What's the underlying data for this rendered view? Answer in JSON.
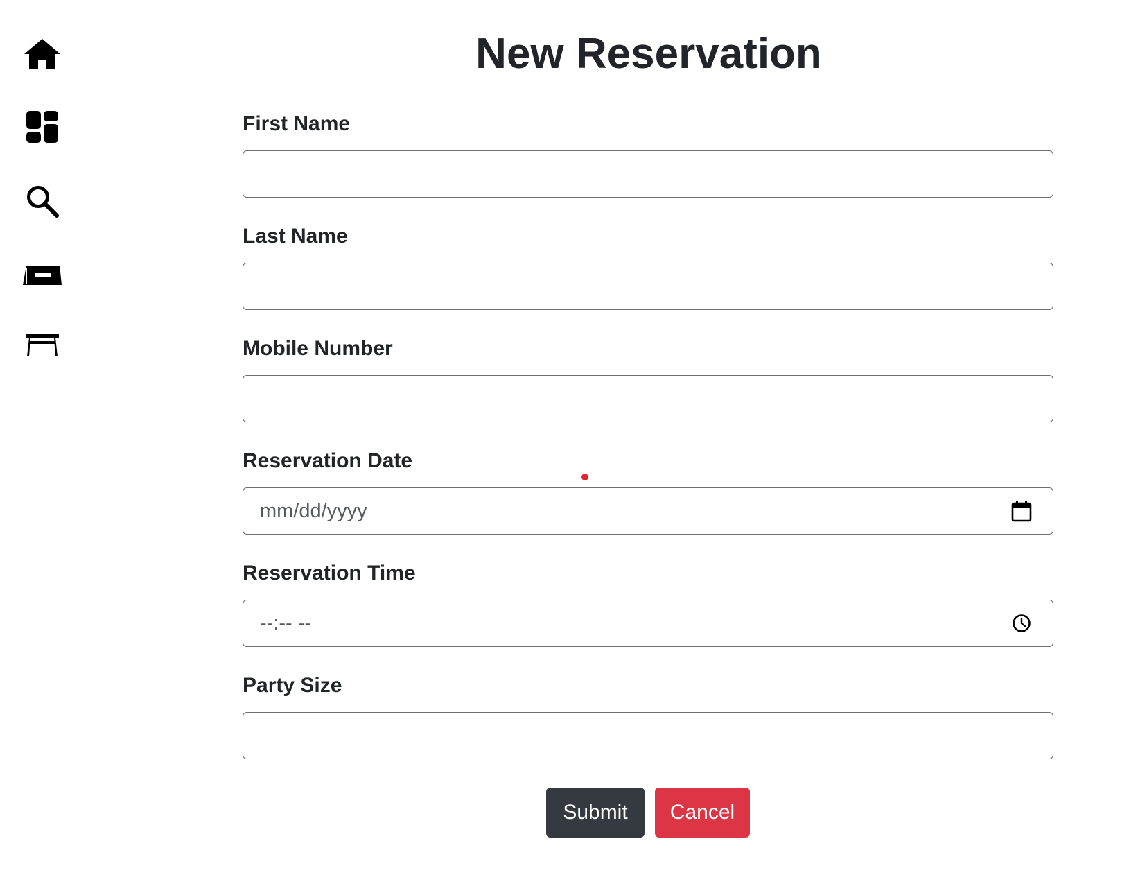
{
  "sidebar": {
    "items": [
      {
        "icon": "home-icon",
        "label": ""
      },
      {
        "icon": "dashboard-icon",
        "label": ""
      },
      {
        "icon": "search-icon",
        "label": ""
      },
      {
        "icon": "reservation-ticket-icon",
        "label": ""
      },
      {
        "icon": "table-icon",
        "label": ""
      }
    ]
  },
  "page": {
    "title": "New Reservation"
  },
  "form": {
    "first_name": {
      "label": "First Name",
      "value": "",
      "placeholder": ""
    },
    "last_name": {
      "label": "Last Name",
      "value": "",
      "placeholder": ""
    },
    "mobile_number": {
      "label": "Mobile Number",
      "value": "",
      "placeholder": ""
    },
    "reservation_date": {
      "label": "Reservation Date",
      "value": "",
      "placeholder": "mm/dd/yyyy",
      "icon": "calendar-icon"
    },
    "reservation_time": {
      "label": "Reservation Time",
      "value": "",
      "placeholder": "--:-- --",
      "icon": "clock-icon"
    },
    "party_size": {
      "label": "Party Size",
      "value": "",
      "placeholder": ""
    }
  },
  "actions": {
    "submit_label": "Submit",
    "cancel_label": "Cancel"
  },
  "colors": {
    "submit_bg": "#343a40",
    "cancel_bg": "#dc3545",
    "text": "#212529",
    "cursor_marker": "#e3262d"
  }
}
